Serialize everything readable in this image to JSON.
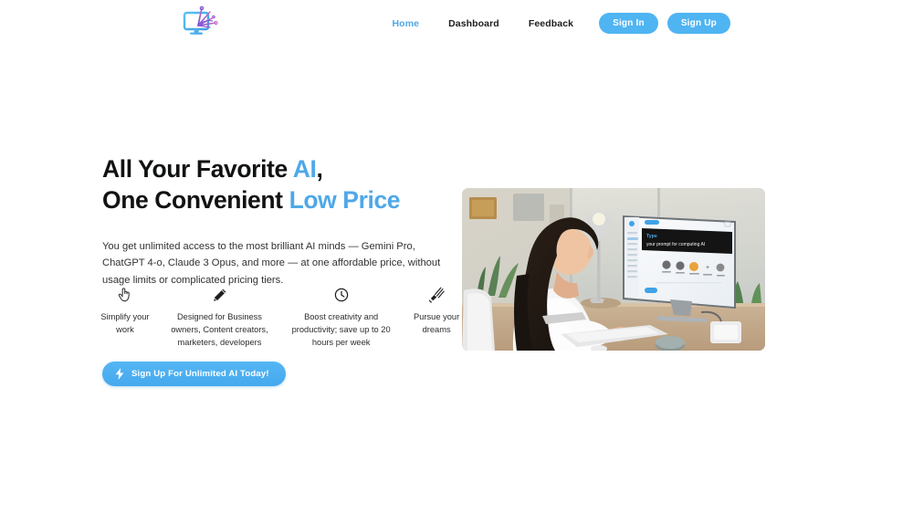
{
  "brand": {
    "logo_icon": "monitor-circuit-logo"
  },
  "nav": {
    "links": [
      {
        "label": "Home",
        "active": true
      },
      {
        "label": "Dashboard",
        "active": false
      },
      {
        "label": "Feedback",
        "active": false
      }
    ],
    "sign_in_label": "Sign In",
    "sign_up_label": "Sign Up"
  },
  "hero": {
    "headline_line1_plain": "All Your Favorite ",
    "headline_line1_accent": "AI",
    "headline_line1_tail": ",",
    "headline_line2_plain": "One Convenient ",
    "headline_line2_accent": "Low Price",
    "subtext": "You get unlimited access to the most brilliant AI minds — Gemini Pro, ChatGPT 4-o, Claude 3 Opus, and more — at one affordable price, without usage limits or complicated pricing tiers.",
    "cta_label": "Sign Up For Unlimited AI Today!",
    "cta_icon": "lightning-bolt-icon",
    "image_alt": "woman-at-desk-using-ai-app-on-monitor",
    "image_screen_text_line1": "Type",
    "image_screen_text_line2": "your prompt for computing AI"
  },
  "features": [
    {
      "icon": "pointing-hand-icon",
      "label": "Simplify your work"
    },
    {
      "icon": "pencil-icon",
      "label": "Designed for Business owners, Content creators, marketers, developers"
    },
    {
      "icon": "clock-icon",
      "label": "Boost creativity and productivity; save up to 20 hours per week"
    },
    {
      "icon": "shooting-star-icon",
      "label": "Pursue your dreams"
    }
  ],
  "colors": {
    "accent_blue": "#4FA8E8",
    "button_blue": "#4FB4F2",
    "text_dark": "#111213",
    "background": "#FFFFFF"
  }
}
